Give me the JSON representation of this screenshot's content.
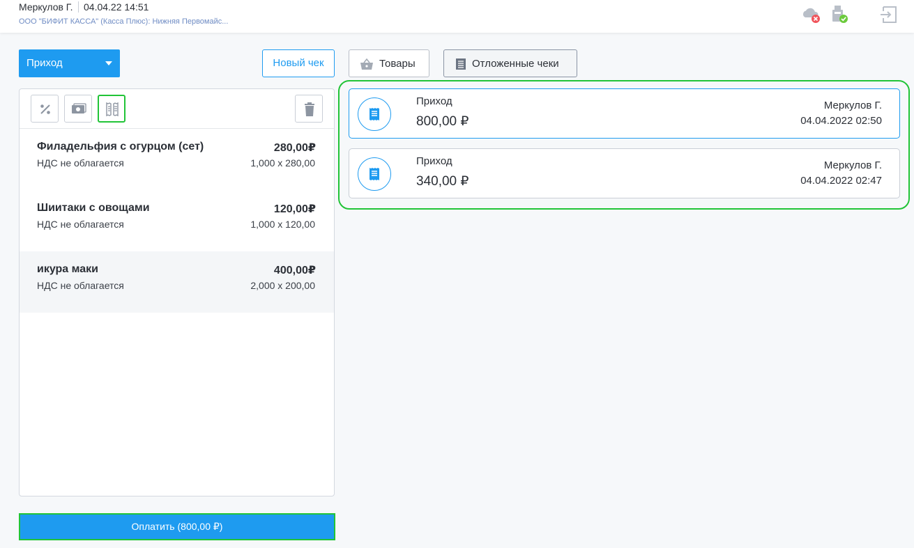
{
  "header": {
    "user": "Меркулов Г.",
    "datetime": "04.04.22 14:51",
    "organization": "ООО \"БИФИТ КАССА\" (Касса Плюс): Нижняя Первомайс...",
    "icons": [
      "cloud-offline-icon",
      "fiscal-device-ok-icon",
      "logout-icon"
    ],
    "status_colors": {
      "error": "#f0545b",
      "ok": "#6ccb3d"
    }
  },
  "left": {
    "operation_select": "Приход",
    "new_check_label": "Новый чек",
    "toolbar_icons": [
      "discount-icon",
      "payment-icon",
      "split-check-icon",
      "trash-icon"
    ],
    "items": [
      {
        "name": "Филадельфия с огурцом (сет)",
        "tax": "НДС не облагается",
        "total": "280,00₽",
        "qty_price": "1,000 x 280,00"
      },
      {
        "name": "Шиитаки с овощами",
        "tax": "НДС не облагается",
        "total": "120,00₽",
        "qty_price": "1,000 x 120,00"
      },
      {
        "name": "икура маки",
        "tax": "НДС не облагается",
        "total": "400,00₽",
        "qty_price": "2,000 x 200,00"
      }
    ],
    "pay_label": "Оплатить (800,00 ₽)"
  },
  "right": {
    "goods_label": "Товары",
    "deferred_label": "Отложенные чеки",
    "deferred_checks": [
      {
        "operation": "Приход",
        "sum": "800,00 ₽",
        "cashier": "Меркулов Г.",
        "datetime": "04.04.2022 02:50"
      },
      {
        "operation": "Приход",
        "sum": "340,00 ₽",
        "cashier": "Меркулов Г.",
        "datetime": "04.04.2022 02:47"
      }
    ]
  },
  "colors": {
    "accent": "#1e9bf0",
    "highlight": "#21c437"
  }
}
